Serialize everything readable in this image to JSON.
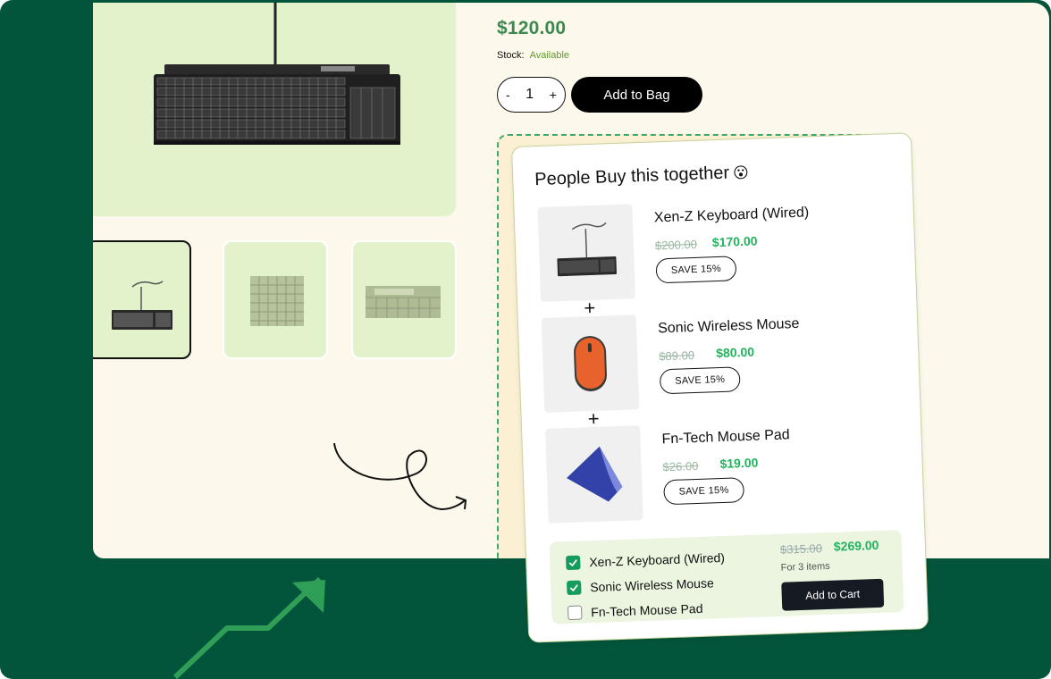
{
  "product": {
    "price": "$120.00",
    "stock_label": "Stock:",
    "stock_value": "Available",
    "quantity": "1",
    "qty_minus": "-",
    "qty_plus": "+",
    "add_to_bag_label": "Add to Bag",
    "thumbnails": [
      {
        "name": "keyboard-full-view",
        "selected": true
      },
      {
        "name": "keyboard-keys-closeup",
        "selected": false
      },
      {
        "name": "keyboard-media-keys-closeup",
        "selected": false
      }
    ]
  },
  "bundle": {
    "title": "People Buy this together",
    "title_emoji": "😮",
    "plus_sign": "+",
    "items": [
      {
        "name": "Xen-Z Keyboard (Wired)",
        "old_price": "$200.00",
        "new_price": "$170.00",
        "badge": "SAVE 15%",
        "image": "keyboard"
      },
      {
        "name": "Sonic Wireless Mouse",
        "old_price": "$89.00",
        "new_price": "$80.00",
        "badge": "SAVE 15%",
        "image": "mouse"
      },
      {
        "name": "Fn-Tech Mouse Pad",
        "old_price": "$26.00",
        "new_price": "$19.00",
        "badge": "SAVE 15%",
        "image": "mouse-pad"
      }
    ],
    "summary": {
      "checks": [
        {
          "label": "Xen-Z Keyboard (Wired)",
          "checked": true
        },
        {
          "label": "Sonic Wireless Mouse",
          "checked": true
        },
        {
          "label": "Fn-Tech Mouse Pad",
          "checked": false
        }
      ],
      "old_total": "$315.00",
      "new_total": "$269.00",
      "count_label": "For 3 items",
      "add_to_cart_label": "Add to Cart"
    }
  },
  "colors": {
    "frame_green": "#02553a",
    "panel_cream": "#fcf8ec",
    "image_bg": "#e2f2cb",
    "price_green": "#3a8a4f",
    "sale_green": "#22b35e",
    "check_green": "#169b5e",
    "arrow_green": "#2f9e57"
  }
}
